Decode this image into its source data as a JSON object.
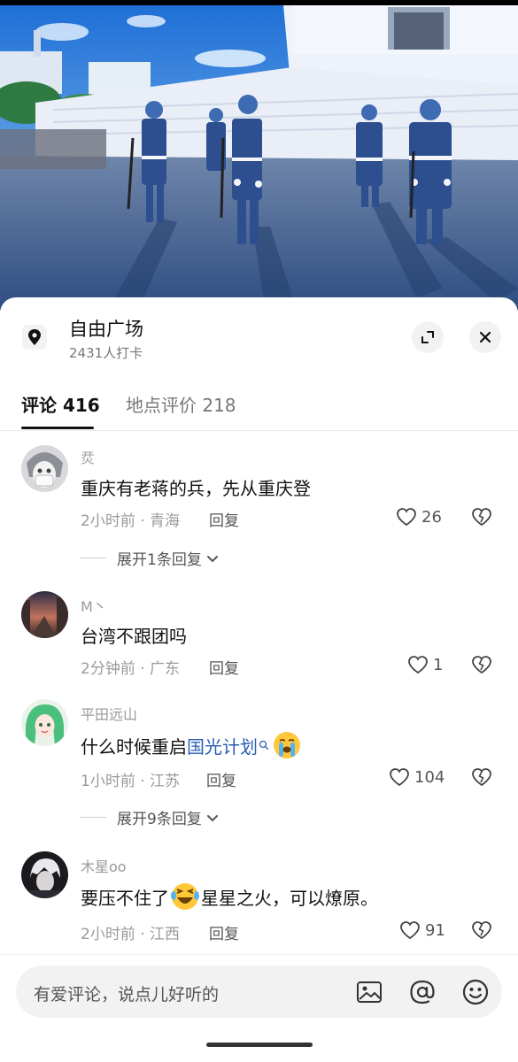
{
  "place": {
    "name": "自由广场",
    "checkins": "2431人打卡"
  },
  "tabs": [
    {
      "label": "评论 416",
      "active": true
    },
    {
      "label": "地点评价 218",
      "active": false
    }
  ],
  "comments": [
    {
      "user": "烎",
      "text": "重庆有老蒋的兵，先从重庆登",
      "time_location": "2小时前 · 青海",
      "reply_label": "回复",
      "likes": "26",
      "expand_label": "展开1条回复"
    },
    {
      "user": "M丶",
      "text": "台湾不跟团吗",
      "time_location": "2分钟前 · 广东",
      "reply_label": "回复",
      "likes": "1"
    },
    {
      "user": "平田远山",
      "text_prefix": "什么时候重启",
      "text_link": "国光计划",
      "emoji": "crying-emoji",
      "time_location": "1小时前 · 江苏",
      "reply_label": "回复",
      "likes": "104",
      "expand_label": "展开9条回复"
    },
    {
      "user": "木星oo",
      "text_prefix": "要压不住了",
      "emoji": "laughing-crying-emoji",
      "text_suffix": "星星之火，可以燎原。",
      "time_location": "2小时前 · 江西",
      "reply_label": "回复",
      "likes": "91"
    }
  ],
  "input": {
    "placeholder": "有爱评论，说点儿好听的"
  },
  "icons": [
    "location-pin-icon",
    "expand-icon",
    "close-icon",
    "heart-icon",
    "broken-heart-icon",
    "chevron-down-icon",
    "search-icon",
    "image-icon",
    "at-icon",
    "emoji-icon"
  ],
  "colors": {
    "link": "#2a5db0",
    "muted_text": "#9a9a9a",
    "primary_text": "#111111",
    "sheet_bg": "#ffffff"
  }
}
